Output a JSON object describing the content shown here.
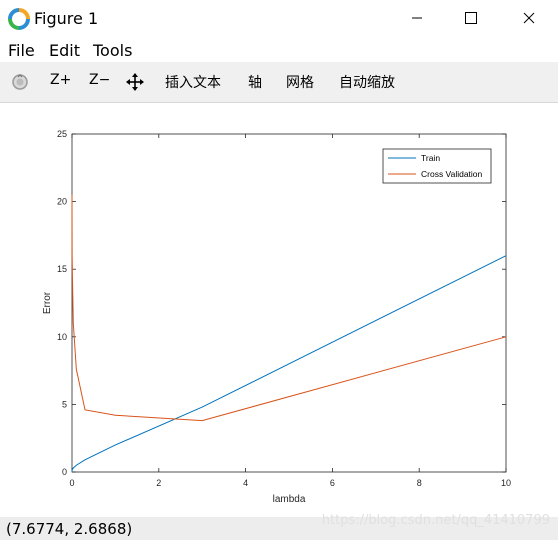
{
  "window": {
    "title": "Figure 1",
    "icon": "matlab-figure-icon",
    "controls": [
      "minimize-icon",
      "maximize-icon",
      "close-icon"
    ]
  },
  "menu": {
    "file": "File",
    "edit": "Edit",
    "tools": "Tools"
  },
  "toolbar": {
    "reset_icon": "reset-view-icon",
    "zoom_in": "Z+",
    "zoom_out": "Z−",
    "pan_icon": "pan-arrows-icon",
    "insert_text": "插入文本",
    "axis": "轴",
    "grid": "网格",
    "autoscale": "自动缩放"
  },
  "status": {
    "coords": "(7.6774, 2.6868)",
    "watermark": "https://blog.csdn.net/qq_41410799"
  },
  "colors": {
    "train": "#0072bd",
    "cv": "#d95319"
  },
  "chart_data": {
    "type": "line",
    "title": "",
    "xlabel": "lambda",
    "ylabel": "Error",
    "xlim": [
      0,
      10
    ],
    "ylim": [
      0,
      25
    ],
    "xticks": [
      "0",
      "2",
      "4",
      "6",
      "8",
      "10"
    ],
    "yticks": [
      "0",
      "5",
      "10",
      "15",
      "20",
      "25"
    ],
    "grid": false,
    "legend_position": "top-right",
    "x": [
      0,
      0.001,
      0.003,
      0.01,
      0.03,
      0.1,
      0.3,
      1,
      3,
      10
    ],
    "series": [
      {
        "name": "Train",
        "color": "#0072bd",
        "values": [
          0.0,
          0.1,
          0.15,
          0.2,
          0.3,
          0.5,
          0.9,
          2.0,
          4.8,
          16.0
        ]
      },
      {
        "name": "Cross Validation",
        "color": "#d95319",
        "values": [
          20.5,
          18.5,
          16.0,
          14.5,
          11.0,
          7.6,
          4.6,
          4.2,
          3.8,
          10.0
        ]
      }
    ]
  }
}
